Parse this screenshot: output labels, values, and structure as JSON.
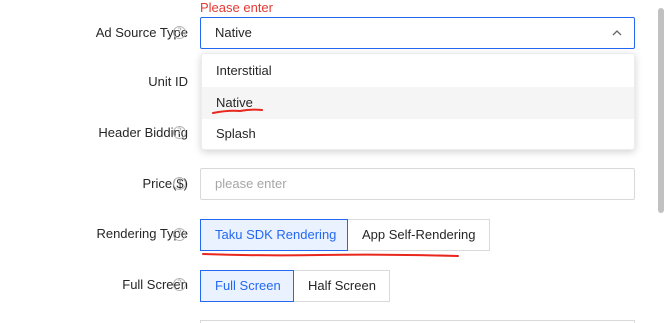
{
  "form": {
    "ad_source_type": {
      "label": "Ad Source Type",
      "error": "Please enter",
      "value": "Native",
      "options": [
        "Interstitial",
        "Native",
        "Splash"
      ]
    },
    "unit_id": {
      "label": "Unit ID"
    },
    "header_bidding": {
      "label": "Header Bidding"
    },
    "price": {
      "label": "Price($)",
      "placeholder": "please enter"
    },
    "rendering_type": {
      "label": "Rendering Type",
      "options": [
        "Taku SDK Rendering",
        "App Self-Rendering"
      ],
      "selected": "Taku SDK Rendering"
    },
    "full_screen": {
      "label": "Full Screen",
      "options": [
        "Full Screen",
        "Half Screen"
      ],
      "selected": "Full Screen"
    }
  },
  "colors": {
    "accent": "#2468f2",
    "error": "#e53935",
    "annotation": "#e8281e"
  },
  "icons": [
    "help-icon",
    "chevron-up-icon"
  ]
}
